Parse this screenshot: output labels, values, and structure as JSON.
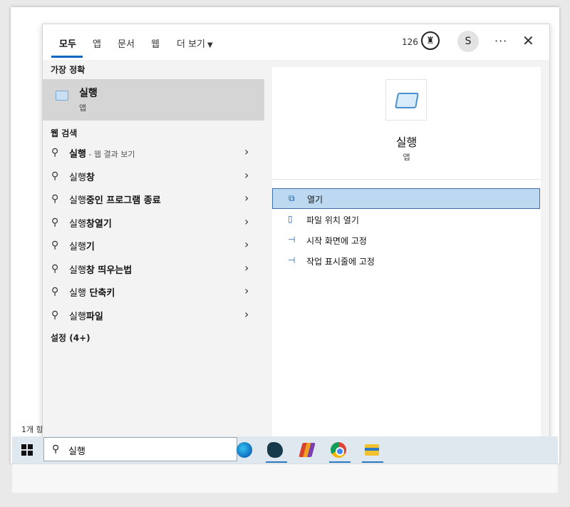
{
  "panel": {
    "tabs": [
      "모두",
      "앱",
      "문서",
      "웹",
      "더 보기"
    ],
    "active_tab": "모두",
    "points": "126",
    "avatar_initial": "S",
    "more_label": "···",
    "close_label": "✕"
  },
  "left": {
    "best_match_title": "가장 정확",
    "best_match": {
      "title": "실행",
      "subtitle": "앱"
    },
    "web_search_title": "웹 검색",
    "web_results": [
      {
        "prefix": "실행",
        "bold": "",
        "suffix": " - 웹 결과 보기"
      },
      {
        "prefix": "실행",
        "bold": "창",
        "suffix": ""
      },
      {
        "prefix": "실행",
        "bold": "중인 프로그램 종료",
        "suffix": ""
      },
      {
        "prefix": "실행",
        "bold": "창열기",
        "suffix": ""
      },
      {
        "prefix": "실행",
        "bold": "기",
        "suffix": ""
      },
      {
        "prefix": "실행",
        "bold": "창 띄우는법",
        "suffix": ""
      },
      {
        "prefix": "실행",
        "bold": " 단축키",
        "suffix": ""
      },
      {
        "prefix": "실행",
        "bold": "파일",
        "suffix": ""
      }
    ],
    "settings_title": "설정 (4+)"
  },
  "right": {
    "app_name": "실행",
    "app_type": "앱",
    "actions": [
      {
        "label": "열기",
        "icon": "open-icon"
      },
      {
        "label": "파일 위치 열기",
        "icon": "file-location-icon"
      },
      {
        "label": "시작 화면에 고정",
        "icon": "pin-icon"
      },
      {
        "label": "작업 표시줄에 고정",
        "icon": "pin-icon"
      }
    ]
  },
  "desktop_label": "1개 항",
  "taskbar": {
    "search_value": "실행",
    "apps": [
      "edge-icon",
      "app-icon",
      "app-icon",
      "chrome-icon",
      "file-explorer-icon"
    ]
  },
  "colors": {
    "accent": "#0067c0",
    "selection": "#bcd9f1"
  }
}
